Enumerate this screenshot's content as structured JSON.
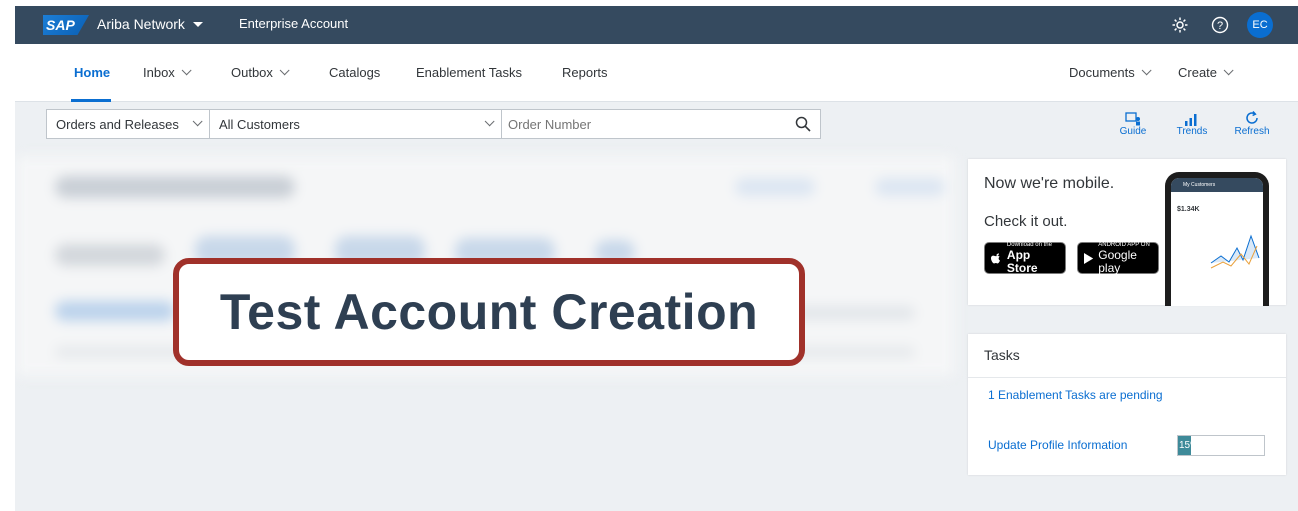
{
  "shell": {
    "logo": "SAP",
    "product": "Ariba Network",
    "account": "Enterprise Account",
    "avatar_initials": "EC",
    "header_bg": "#354a5f",
    "accent": "#0a6ed1"
  },
  "nav": {
    "tabs": [
      {
        "label": "Home",
        "active": true
      },
      {
        "label": "Inbox",
        "dropdown": true
      },
      {
        "label": "Outbox",
        "dropdown": true
      },
      {
        "label": "Catalogs"
      },
      {
        "label": "Enablement Tasks"
      },
      {
        "label": "Reports"
      }
    ],
    "right": [
      {
        "label": "Documents",
        "dropdown": true
      },
      {
        "label": "Create",
        "dropdown": true
      }
    ]
  },
  "search": {
    "doc_type": "Orders and Releases",
    "customer": "All Customers",
    "placeholder": "Order Number"
  },
  "tools": [
    {
      "label": "Guide",
      "icon": "guide-icon"
    },
    {
      "label": "Trends",
      "icon": "bar-chart-icon"
    },
    {
      "label": "Refresh",
      "icon": "refresh-icon"
    }
  ],
  "overlay": {
    "caption": "Test Account Creation",
    "border_color": "#a0312a"
  },
  "mobile": {
    "title": "Now we're mobile.",
    "subtitle": "Check it out.",
    "app_store": {
      "small": "Download on the",
      "big": "App Store"
    },
    "google_play": {
      "small": "ANDROID APP ON",
      "big": "Google play"
    },
    "phone_header": "My Customers",
    "phone_value": "$1.34K"
  },
  "tasks": {
    "title": "Tasks",
    "pending": "1 Enablement Tasks are pending",
    "profile_label": "Update Profile Information",
    "profile_progress_label": "15%",
    "profile_progress": 0.15
  }
}
